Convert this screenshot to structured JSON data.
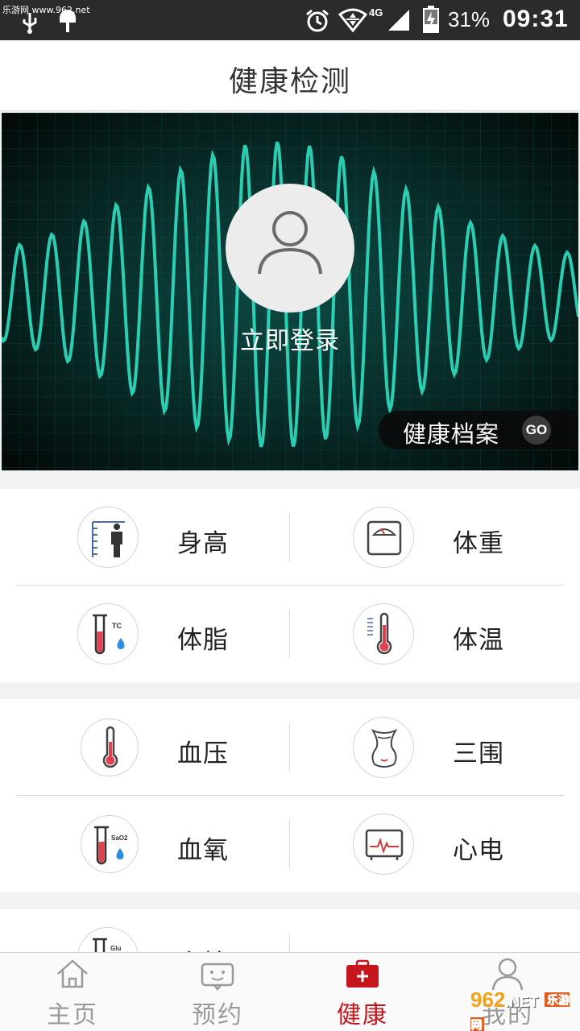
{
  "status_bar": {
    "watermark": "乐游网 www.962.net",
    "battery": "31%",
    "time": "09:31",
    "network": "4G",
    "icons": [
      "usb-icon",
      "android-debug-icon",
      "alarm-icon",
      "wifi-icon",
      "signal-icon",
      "battery-charging-icon"
    ]
  },
  "header": {
    "title": "健康检测"
  },
  "banner": {
    "login_label": "立即登录",
    "archive_label": "健康档案",
    "go_label": "GO"
  },
  "sections": [
    {
      "rows": [
        [
          {
            "label": "身高",
            "icon": "height-icon"
          },
          {
            "label": "体重",
            "icon": "scale-icon"
          }
        ],
        [
          {
            "label": "体脂",
            "icon": "body-fat-tube-icon",
            "icon_text": "TC"
          },
          {
            "label": "体温",
            "icon": "thermometer-icon"
          }
        ]
      ]
    },
    {
      "rows": [
        [
          {
            "label": "血压",
            "icon": "blood-pressure-thermometer-icon"
          },
          {
            "label": "三围",
            "icon": "body-shape-icon"
          }
        ],
        [
          {
            "label": "血氧",
            "icon": "blood-oxygen-tube-icon",
            "icon_text": "SaO2"
          },
          {
            "label": "心电",
            "icon": "ecg-monitor-icon"
          }
        ]
      ]
    },
    {
      "rows": [
        [
          {
            "label": "血糖",
            "icon": "blood-glucose-tube-icon",
            "icon_text": "Glu"
          }
        ]
      ]
    }
  ],
  "bottom_nav": [
    {
      "label": "主页",
      "icon": "home-icon",
      "active": false
    },
    {
      "label": "预约",
      "icon": "appointment-icon",
      "active": false
    },
    {
      "label": "健康",
      "icon": "medical-kit-icon",
      "active": true
    },
    {
      "label": "我的",
      "icon": "user-icon",
      "active": false
    }
  ],
  "watermark_bottom": {
    "brand": "962",
    "suffix": ".NET",
    "sub": "乐游网"
  },
  "colors": {
    "accent": "#c4161c",
    "wave": "#2ee0c2",
    "inactive": "#9a9a9a"
  }
}
